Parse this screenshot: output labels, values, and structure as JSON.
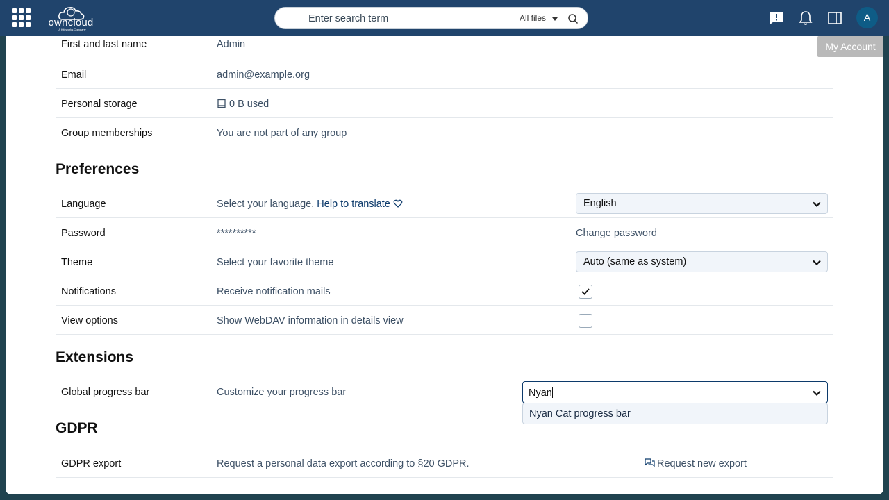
{
  "topbar": {
    "logo_text": "owncloud",
    "logo_sub": "A Kiteworks Company",
    "search_placeholder": "Enter search term",
    "search_scope": "All files",
    "avatar_initial": "A",
    "tooltip": "My Account"
  },
  "account": {
    "rows": [
      {
        "label": "First and last name",
        "value": "Admin"
      },
      {
        "label": "Email",
        "value": "admin@example.org"
      },
      {
        "label": "Personal storage",
        "value": "0 B used"
      },
      {
        "label": "Group memberships",
        "value": "You are not part of any group"
      }
    ]
  },
  "preferences": {
    "heading": "Preferences",
    "language": {
      "label": "Language",
      "desc": "Select your language.",
      "help_link": "Help to translate",
      "selected": "English"
    },
    "password": {
      "label": "Password",
      "value": "**********",
      "action": "Change password"
    },
    "theme": {
      "label": "Theme",
      "desc": "Select your favorite theme",
      "selected": "Auto (same as system)"
    },
    "notifications": {
      "label": "Notifications",
      "desc": "Receive notification mails",
      "checked": true
    },
    "view_options": {
      "label": "View options",
      "desc": "Show WebDAV information in details view",
      "checked": false
    }
  },
  "extensions": {
    "heading": "Extensions",
    "progress_bar": {
      "label": "Global progress bar",
      "desc": "Customize your progress bar",
      "typed": "Nyan",
      "option": "Nyan Cat progress bar"
    }
  },
  "gdpr": {
    "heading": "GDPR",
    "export": {
      "label": "GDPR export",
      "desc": "Request a personal data export according to §20 GDPR.",
      "action": "Request new export"
    }
  },
  "colors": {
    "topbar": "#20446c",
    "accent": "#0c3a6b",
    "avatar": "#0e5c86"
  }
}
